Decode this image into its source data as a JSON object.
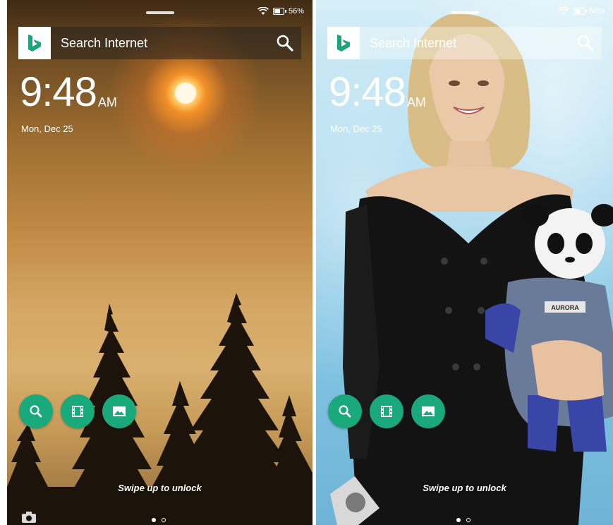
{
  "colors": {
    "shortcut_green": "#19a97a",
    "bing_green": "#1ba57a",
    "text": "#ffffff"
  },
  "screens": [
    {
      "status": {
        "battery_text": "56%",
        "battery_level": 0.56
      },
      "search": {
        "placeholder": "Search Internet",
        "logo": "bing-logo-icon",
        "icon": "search-icon"
      },
      "clock": {
        "time": "9:48",
        "ampm": "AM",
        "date": "Mon, Dec 25"
      },
      "shortcuts": [
        {
          "icon": "search-icon"
        },
        {
          "icon": "video-icon"
        },
        {
          "icon": "gallery-icon"
        }
      ],
      "unlock_hint": "Swipe up to unlock",
      "page_indicator": {
        "count": 2,
        "active": 1
      },
      "camera_icon": "camera-icon",
      "wallpaper": "sunset-forest"
    },
    {
      "status": {
        "battery_text": "56%",
        "battery_level": 0.56
      },
      "search": {
        "placeholder": "Search Internet",
        "logo": "bing-logo-icon",
        "icon": "search-icon"
      },
      "clock": {
        "time": "9:48",
        "ampm": "AM",
        "date": "Mon, Dec 25"
      },
      "shortcuts": [
        {
          "icon": "search-icon"
        },
        {
          "icon": "video-icon"
        },
        {
          "icon": "gallery-icon"
        }
      ],
      "unlock_hint": "Swipe up to unlock",
      "page_indicator": {
        "count": 2,
        "active": 1
      },
      "wallpaper": "woman-with-panda-plush",
      "plush_badge": "AURORA"
    }
  ]
}
